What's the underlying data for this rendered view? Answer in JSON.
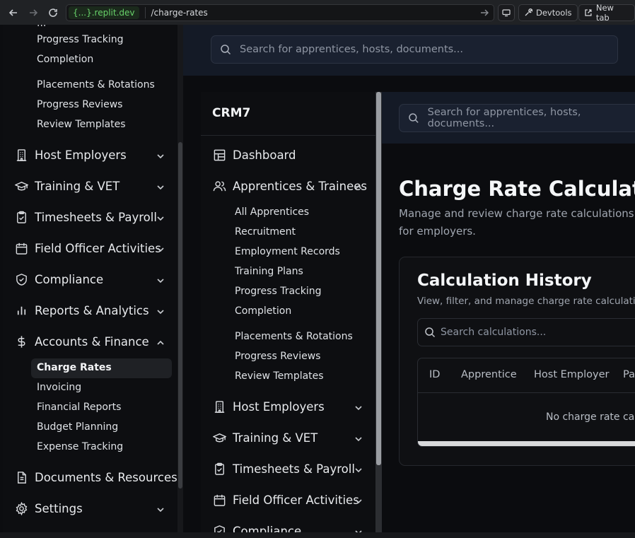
{
  "browser": {
    "url_host": "{...}.replit.dev",
    "url_path": "/charge-rates",
    "devtools_label": "Devtools",
    "newtab_label": "New tab"
  },
  "outer_sidebar": {
    "sub_top": [
      "Progress Tracking",
      "Completion",
      "Placements & Rotations",
      "Progress Reviews",
      "Review Templates"
    ],
    "nav": [
      {
        "label": "Host Employers",
        "icon": "building-icon",
        "expanded": false
      },
      {
        "label": "Training & VET",
        "icon": "graduation-cap-icon",
        "expanded": false
      },
      {
        "label": "Timesheets & Payroll",
        "icon": "clipboard-check-icon",
        "expanded": false
      },
      {
        "label": "Field Officer Activities",
        "icon": "calendar-icon",
        "expanded": false
      },
      {
        "label": "Compliance",
        "icon": "shield-check-icon",
        "expanded": false
      },
      {
        "label": "Reports & Analytics",
        "icon": "bar-chart-icon",
        "expanded": false
      },
      {
        "label": "Accounts & Finance",
        "icon": "dollar-icon",
        "expanded": true
      }
    ],
    "finance_items": [
      "Charge Rates",
      "Invoicing",
      "Financial Reports",
      "Budget Planning",
      "Expense Tracking"
    ],
    "bottom_nav": [
      {
        "label": "Documents & Resources",
        "icon": "file-text-icon"
      },
      {
        "label": "Settings",
        "icon": "gear-icon"
      }
    ]
  },
  "search": {
    "placeholder": "Search for apprentices, hosts, documents..."
  },
  "inner_sidebar": {
    "brand": "CRM7",
    "dashboard": "Dashboard",
    "apprentices": "Apprentices & Trainees",
    "apprentice_items": [
      "All Apprentices",
      "Recruitment",
      "Employment Records",
      "Training Plans",
      "Progress Tracking",
      "Completion",
      "Placements & Rotations",
      "Progress Reviews",
      "Review Templates"
    ],
    "nav": [
      "Host Employers",
      "Training & VET",
      "Timesheets & Payroll",
      "Field Officer Activities",
      "Compliance"
    ]
  },
  "main": {
    "title": "Charge Rate Calculations",
    "subtitle": "Manage and review charge rate calculations for employers.",
    "card": {
      "title": "Calculation History",
      "subtitle": "View, filter, and manage charge rate calculations.",
      "search_placeholder": "Search calculations...",
      "columns": [
        "ID",
        "Apprentice",
        "Host Employer",
        "Pay"
      ],
      "empty_text": "No charge rate calculations"
    }
  },
  "colors": {
    "accent_green": "#68d26a",
    "header_bg": "#141a26"
  }
}
